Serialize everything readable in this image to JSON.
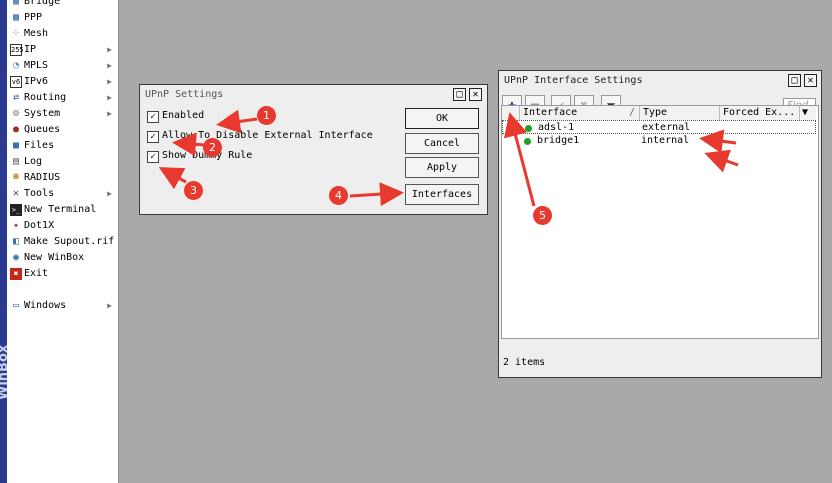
{
  "app": {
    "brand": "WinBox"
  },
  "sidebar": {
    "items": [
      {
        "label": "Bridge",
        "icon": "bridge-icon",
        "arrow": false
      },
      {
        "label": "PPP",
        "icon": "ppp-icon",
        "arrow": false
      },
      {
        "label": "Mesh",
        "icon": "mesh-icon",
        "arrow": false
      },
      {
        "label": "IP",
        "icon": "ip-icon",
        "arrow": true
      },
      {
        "label": "MPLS",
        "icon": "mpls-icon",
        "arrow": true
      },
      {
        "label": "IPv6",
        "icon": "ipv6-icon",
        "arrow": true
      },
      {
        "label": "Routing",
        "icon": "routing-icon",
        "arrow": true
      },
      {
        "label": "System",
        "icon": "system-icon",
        "arrow": true
      },
      {
        "label": "Queues",
        "icon": "queues-icon",
        "arrow": false
      },
      {
        "label": "Files",
        "icon": "files-icon",
        "arrow": false
      },
      {
        "label": "Log",
        "icon": "log-icon",
        "arrow": false
      },
      {
        "label": "RADIUS",
        "icon": "radius-icon",
        "arrow": false
      },
      {
        "label": "Tools",
        "icon": "tools-icon",
        "arrow": true
      },
      {
        "label": "New Terminal",
        "icon": "terminal-icon",
        "arrow": false
      },
      {
        "label": "Dot1X",
        "icon": "dot1x-icon",
        "arrow": false
      },
      {
        "label": "Make Supout.rif",
        "icon": "supout-icon",
        "arrow": false
      },
      {
        "label": "New WinBox",
        "icon": "winbox-icon",
        "arrow": false
      },
      {
        "label": "Exit",
        "icon": "exit-icon",
        "arrow": false
      },
      {
        "label": "Windows",
        "icon": "windows-icon",
        "arrow": true
      }
    ]
  },
  "upnp_settings": {
    "title": "UPnP Settings",
    "options": [
      {
        "label": "Enabled",
        "checked": true
      },
      {
        "label": "Allow To Disable External Interface",
        "checked": true
      },
      {
        "label": "Show Dummy Rule",
        "checked": true
      }
    ],
    "buttons": {
      "ok": "OK",
      "cancel": "Cancel",
      "apply": "Apply",
      "interfaces": "Interfaces"
    }
  },
  "interface_settings": {
    "title": "UPnP Interface Settings",
    "find_placeholder": "Find",
    "columns": [
      "Interface",
      "Type",
      "Forced Ex..."
    ],
    "sort_marker": "/",
    "rows": [
      {
        "interface": "adsl-1",
        "type": "external"
      },
      {
        "interface": "bridge1",
        "type": "internal"
      }
    ],
    "status": "2 items"
  },
  "annotations": [
    "1",
    "2",
    "3",
    "4",
    "5"
  ],
  "colors": {
    "annotation": "#e8392e",
    "enabled_dot": "#22a022",
    "stripe": "#2a3a8e"
  }
}
